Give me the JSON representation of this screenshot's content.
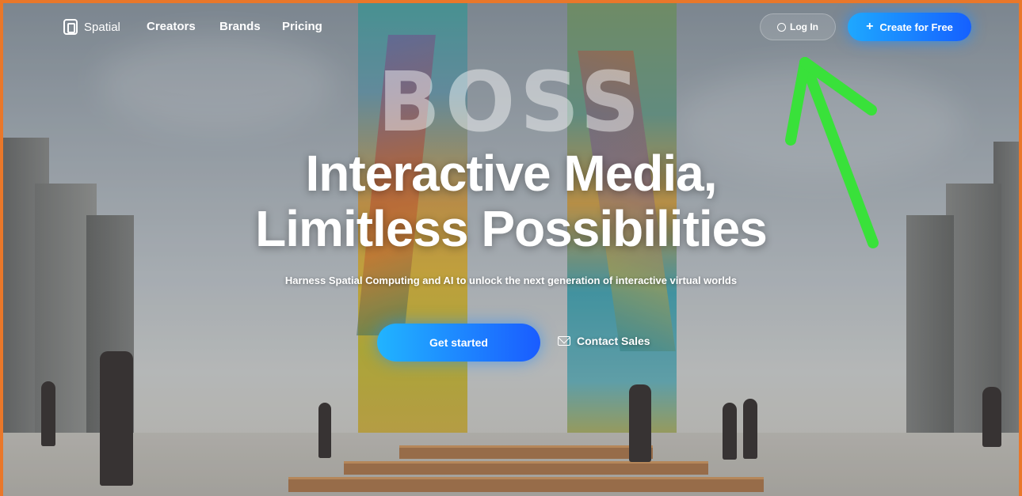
{
  "nav": {
    "brand": "Spatial",
    "links": [
      "Creators",
      "Brands",
      "Pricing"
    ],
    "login_label": "Log In",
    "create_label": "Create for Free"
  },
  "hero": {
    "background_word": "BOSS",
    "headline_line1": "Interactive Media,",
    "headline_line2": "Limitless Possibilities",
    "subtitle": "Harness Spatial Computing and AI to unlock the next generation of interactive virtual worlds",
    "get_started_label": "Get started",
    "contact_sales_label": "Contact Sales"
  },
  "colors": {
    "frame_border": "#e9772a",
    "accent_blue": "#1a8cff",
    "annotation_arrow": "#39e13a"
  },
  "icons": [
    "logo-icon",
    "user-icon",
    "plus-icon",
    "mail-icon"
  ],
  "annotation": "green-arrow-pointing-to-log-in"
}
